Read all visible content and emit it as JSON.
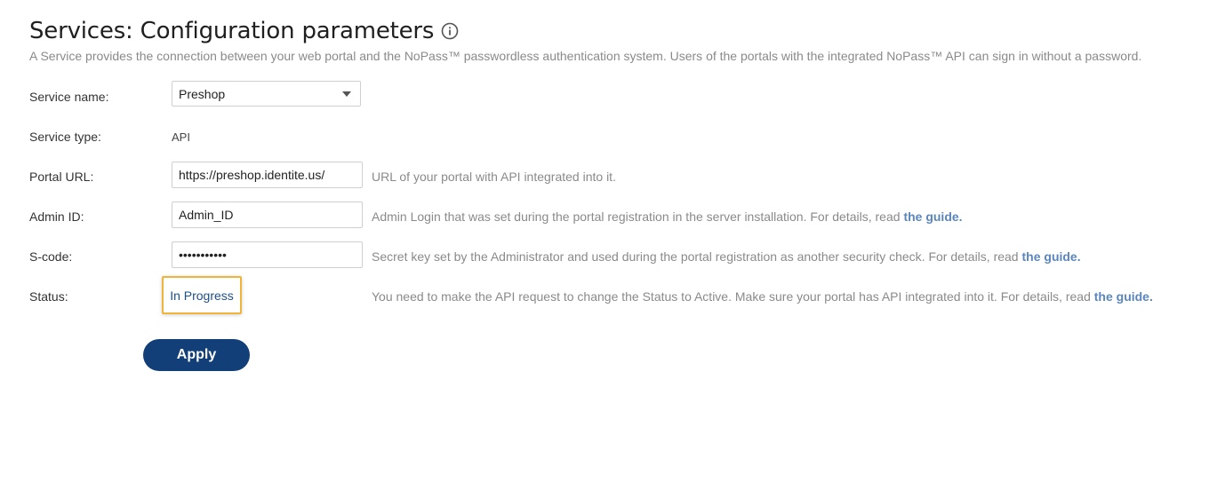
{
  "header": {
    "title": "Services: Configuration parameters",
    "info_icon": "info-circle-icon",
    "description": "A Service provides the connection between your web portal and the NoPass™ passwordless authentication system. Users of the portals with the integrated NoPass™ API can sign in without a password."
  },
  "form": {
    "service_name": {
      "label": "Service name:",
      "selected_value": "Preshop"
    },
    "service_type": {
      "label": "Service type:",
      "value": "API"
    },
    "portal_url": {
      "label": "Portal URL:",
      "value": "https://preshop.identite.us/",
      "help": "URL of your portal with API integrated into it."
    },
    "admin_id": {
      "label": "Admin ID:",
      "value": "Admin_ID",
      "help": "Admin Login that was set during the portal registration in the server installation. For details, read ",
      "link": "the guide."
    },
    "s_code": {
      "label": "S-code:",
      "value": "•••••••••••",
      "help": "Secret key set by the Administrator and used during the portal registration as another security check. For details, read ",
      "link": "the guide."
    },
    "status": {
      "label": "Status:",
      "value": "In Progress",
      "help": "You need to make the API request to change the Status to Active. Make sure your portal has API integrated into it. For details, read ",
      "link": "the guide."
    }
  },
  "actions": {
    "apply_label": "Apply"
  },
  "colors": {
    "accent": "#123f78",
    "link": "#5b86bd",
    "highlight": "#f0b43a"
  }
}
